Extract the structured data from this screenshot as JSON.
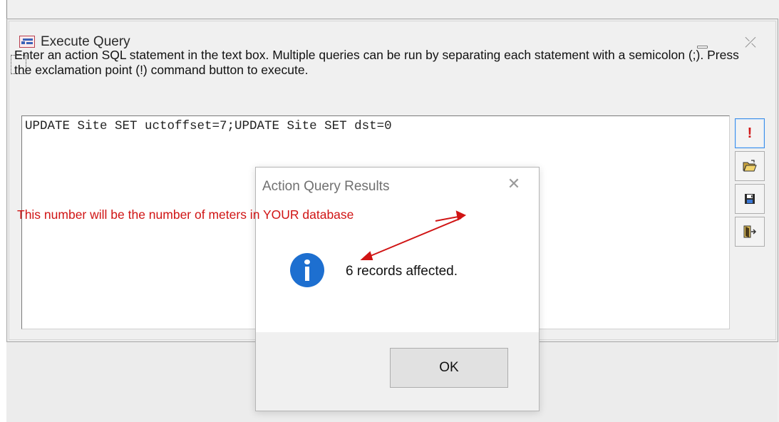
{
  "window": {
    "title": "Execute Query",
    "instructions": "Enter an action SQL statement in the text box.  Multiple queries can be run by separating each statement with a semicolon (;).  Press the exclamation point (!) command button to execute.",
    "sql_value": "UPDATE Site SET uctoffset=7;UPDATE Site SET dst=0",
    "execute_glyph": "!"
  },
  "annotation": {
    "note": "This number will be the number of meters in YOUR database",
    "color": "#d01414"
  },
  "dialog": {
    "title": "Action Query Results",
    "message": "6 records affected.",
    "ok_label": "OK",
    "icon": "info-icon",
    "icon_color": "#1d6fd0"
  },
  "side_buttons": [
    {
      "icon": "exclamation-icon"
    },
    {
      "icon": "open-folder-icon"
    },
    {
      "icon": "save-disk-icon"
    },
    {
      "icon": "exit-door-icon"
    }
  ]
}
